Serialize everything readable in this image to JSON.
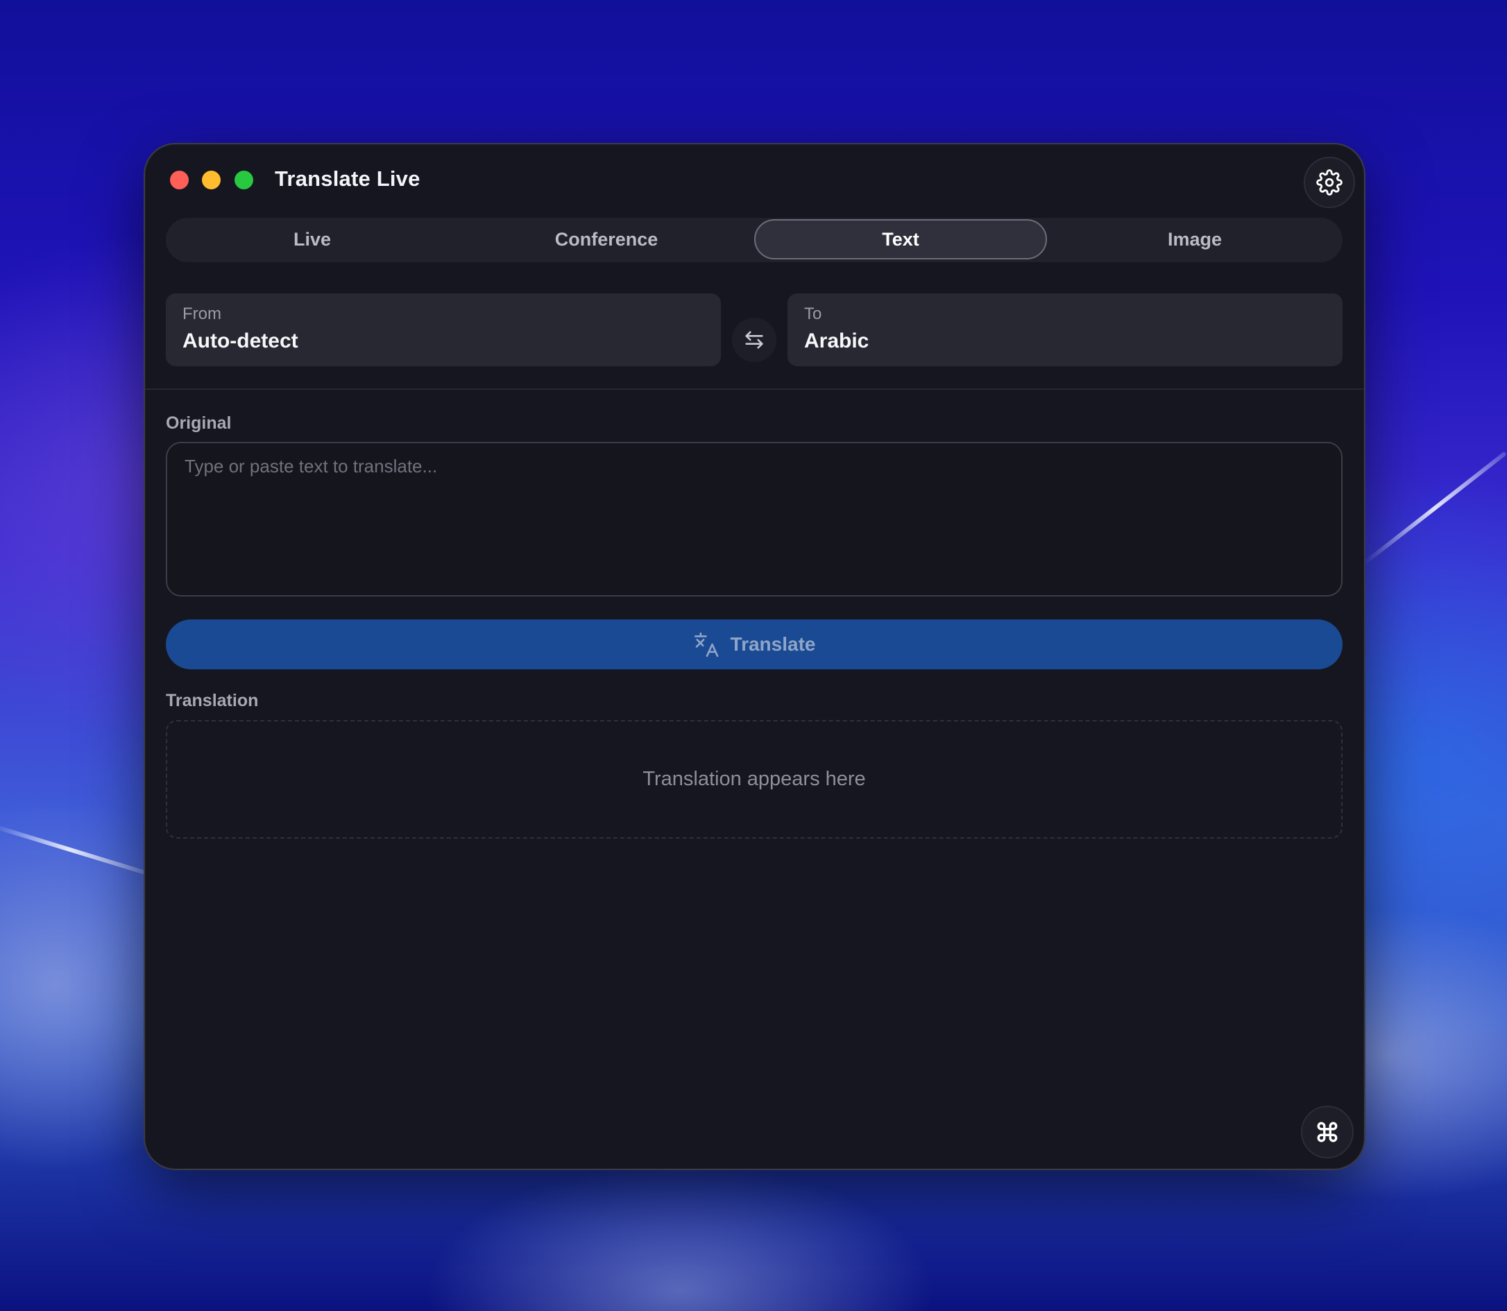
{
  "window": {
    "title": "Translate Live"
  },
  "tabs": [
    {
      "label": "Live",
      "active": false
    },
    {
      "label": "Conference",
      "active": false
    },
    {
      "label": "Text",
      "active": true
    },
    {
      "label": "Image",
      "active": false
    }
  ],
  "languages": {
    "from_caption": "From",
    "from_value": "Auto-detect",
    "to_caption": "To",
    "to_value": "Arabic"
  },
  "original": {
    "label": "Original",
    "placeholder": "Type or paste text to translate...",
    "value": ""
  },
  "translate_button": {
    "label": "Translate"
  },
  "translation": {
    "label": "Translation",
    "placeholder": "Translation appears here"
  },
  "icons": {
    "settings": "gear-icon",
    "swap": "swap-arrows-icon",
    "translate": "translate-icon",
    "fab": "command-icon"
  },
  "colors": {
    "accent": "#1a4a93",
    "window_bg": "#15161f",
    "close": "#fe5f57",
    "minimize": "#febc2e",
    "zoom": "#28c840"
  }
}
